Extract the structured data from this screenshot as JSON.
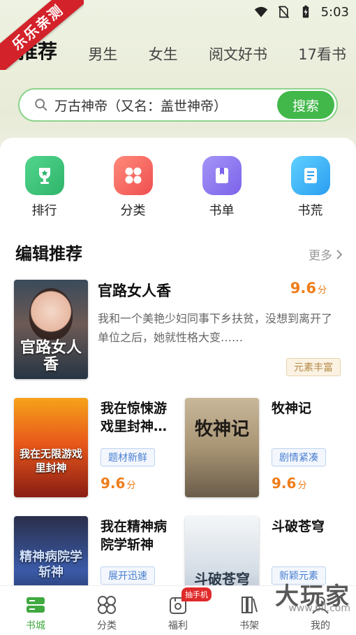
{
  "status_bar": {
    "time": "5:03"
  },
  "ribbon": "乐乐亲测",
  "tabs": [
    {
      "label": "推荐",
      "active": true
    },
    {
      "label": "男生"
    },
    {
      "label": "女生"
    },
    {
      "label": "阅文好书"
    },
    {
      "label": "17看书"
    }
  ],
  "search": {
    "value": "万古神帝（又名：盖世神帝）",
    "button": "搜索"
  },
  "quick": [
    {
      "label": "排行",
      "icon": "trophy-icon",
      "color": "#3cc37a"
    },
    {
      "label": "分类",
      "icon": "grid-icon",
      "color": "#f46464"
    },
    {
      "label": "书单",
      "icon": "booklist-icon",
      "color": "#8e79f0"
    },
    {
      "label": "书荒",
      "icon": "book-icon",
      "color": "#3fb3f2"
    }
  ],
  "section": {
    "title": "编辑推荐",
    "more": "更多"
  },
  "featured": {
    "title": "官路女人香",
    "cover_text": "官路女人香",
    "score": "9.6",
    "score_unit": "分",
    "desc": "我和一个美艳少妇同事下乡扶贫，没想到离开了单位之后，她就性格大变……",
    "tag": "元素丰富"
  },
  "grid": [
    {
      "title": "我在惊悚游戏里封神…",
      "cover_text": "我在无限游戏里封神",
      "tag": "题材新鲜",
      "score": "9.6",
      "unit": "分"
    },
    {
      "title": "牧神记",
      "cover_text": "牧神记",
      "tag": "剧情紧凑",
      "score": "9.6",
      "unit": "分"
    },
    {
      "title": "我在精神病院学斩神",
      "cover_text": "精神病院学斩神",
      "tag": "展开迅速"
    },
    {
      "title": "斗破苍穹",
      "cover_text": "斗破苍穹",
      "tag": "新颖元素"
    }
  ],
  "nav": [
    {
      "label": "书城",
      "icon": "bookstore-icon",
      "active": true
    },
    {
      "label": "分类",
      "icon": "category-icon"
    },
    {
      "label": "福利",
      "icon": "gift-icon",
      "badge": "抽手机"
    },
    {
      "label": "书架",
      "icon": "bookshelf-icon"
    },
    {
      "label": "我的",
      "icon": "profile-icon"
    }
  ],
  "watermark": "大玩家",
  "watermark_sub": "www.6ll.com",
  "colors": {
    "accent": "#42b84a",
    "score": "#ef7d1a",
    "tag_blue": "#4a7fd0"
  }
}
